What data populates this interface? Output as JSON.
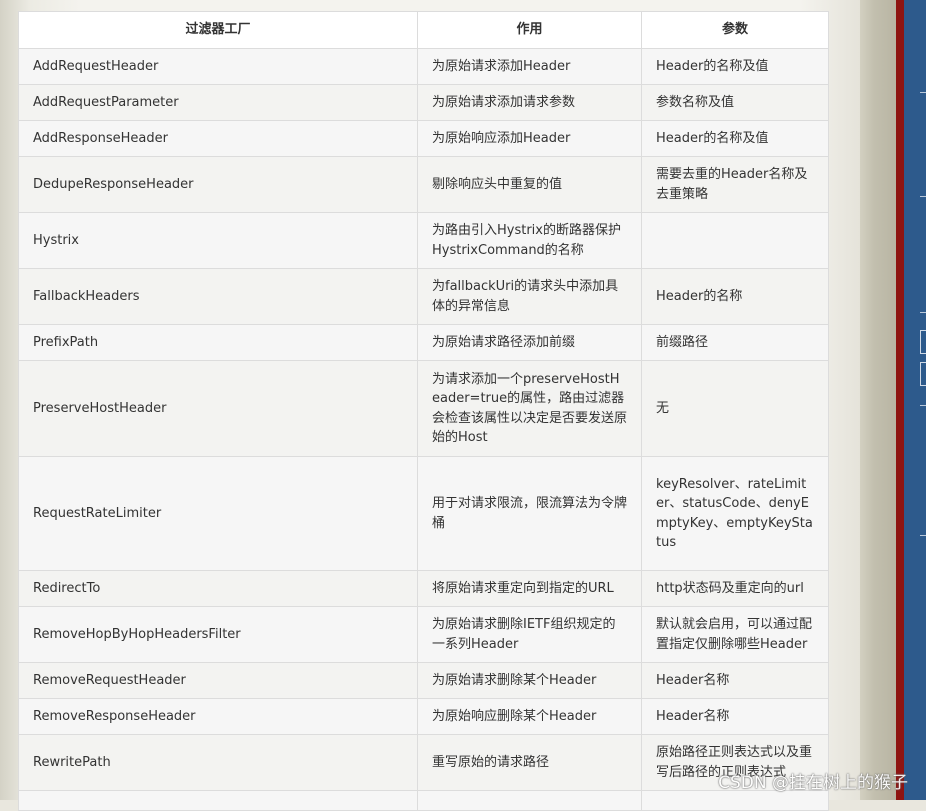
{
  "table": {
    "headers": [
      "过滤器工厂",
      "作用",
      "参数"
    ],
    "rows": [
      {
        "name": "AddRequestHeader",
        "effect": "为原始请求添加Header",
        "params": "Header的名称及值"
      },
      {
        "name": "AddRequestParameter",
        "effect": "为原始请求添加请求参数",
        "params": "参数名称及值"
      },
      {
        "name": "AddResponseHeader",
        "effect": "为原始响应添加Header",
        "params": "Header的名称及值"
      },
      {
        "name": "DedupeResponseHeader",
        "effect": "剔除响应头中重复的值",
        "params": "需要去重的Header名称及去重策略"
      },
      {
        "name": "Hystrix",
        "effect": "为路由引入Hystrix的断路器保护HystrixCommand的名称",
        "params": ""
      },
      {
        "name": "FallbackHeaders",
        "effect": "为fallbackUri的请求头中添加具体的异常信息",
        "params": "Header的名称"
      },
      {
        "name": "PrefixPath",
        "effect": "为原始请求路径添加前缀",
        "params": "前缀路径"
      },
      {
        "name": "PreserveHostHeader",
        "effect": "为请求添加一个preserveHostHeader=true的属性，路由过滤器会检查该属性以决定是否要发送原始的Host",
        "params": "无"
      },
      {
        "name": "RequestRateLimiter",
        "effect": "用于对请求限流，限流算法为令牌桶",
        "params": "keyResolver、rateLimiter、statusCode、denyEmptyKey、emptyKeyStatus"
      },
      {
        "name": "RedirectTo",
        "effect": "将原始请求重定向到指定的URL",
        "params": "http状态码及重定向的url"
      },
      {
        "name": "RemoveHopByHopHeadersFilter",
        "effect": "为原始请求删除IETF组织规定的一系列Header",
        "params": "默认就会启用，可以通过配置指定仅删除哪些Header"
      },
      {
        "name": "RemoveRequestHeader",
        "effect": "为原始请求删除某个Header",
        "params": "Header名称"
      },
      {
        "name": "RemoveResponseHeader",
        "effect": "为原始响应删除某个Header",
        "params": "Header名称"
      },
      {
        "name": "RewritePath",
        "effect": "重写原始的请求路径",
        "params": "原始路径正则表达式以及重写后路径的正则表达式"
      },
      {
        "name": "",
        "effect": "",
        "params": ""
      }
    ]
  },
  "watermark": "CSDN @挂在树上的猴子"
}
